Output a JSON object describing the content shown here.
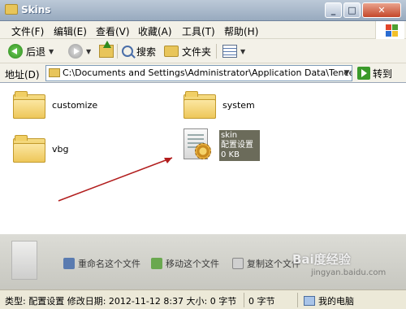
{
  "window": {
    "title": "Skins"
  },
  "menu": [
    "文件(F)",
    "编辑(E)",
    "查看(V)",
    "收藏(A)",
    "工具(T)",
    "帮助(H)"
  ],
  "toolbar": {
    "back_label": "后退",
    "search_label": "搜索",
    "folders_label": "文件夹"
  },
  "address": {
    "label": "地址(D)",
    "value": "C:\\Documents and Settings\\Administrator\\Application Data\\Tencent\\QQ\\Skins",
    "go_label": "转到"
  },
  "files": [
    {
      "name": "customize",
      "type": "folder"
    },
    {
      "name": "system",
      "type": "folder"
    },
    {
      "name": "vbg",
      "type": "folder"
    },
    {
      "name": "skin",
      "type": "配置设置",
      "size": "0 KB"
    }
  ],
  "tasks": [
    "重命名这个文件",
    "移动这个文件",
    "复制这个文件"
  ],
  "watermark": {
    "text": "Bai度经验",
    "url": "jingyan.baidu.com"
  },
  "status": {
    "info": "类型: 配置设置 修改日期: 2012-11-12 8:37 大小: 0 字节",
    "size": "0 字节",
    "location": "我的电脑"
  }
}
